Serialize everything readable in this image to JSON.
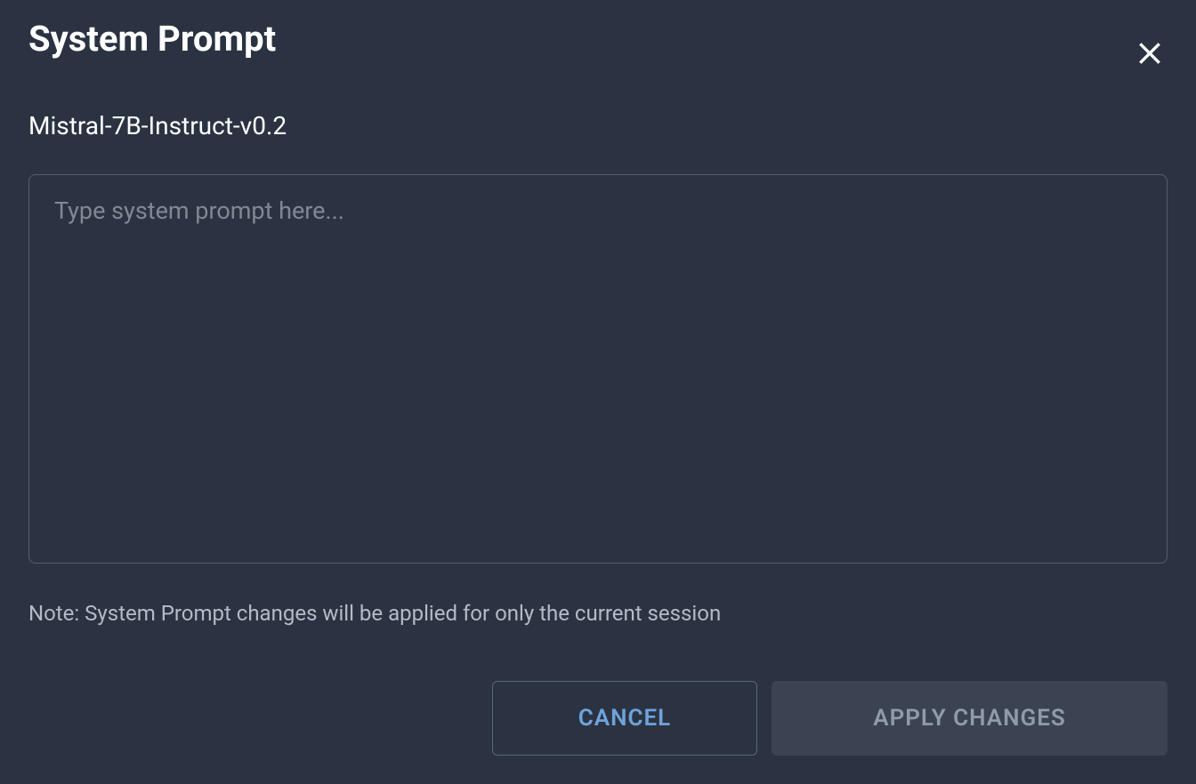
{
  "modal": {
    "title": "System Prompt",
    "model_name": "Mistral-7B-Instruct-v0.2",
    "textarea_placeholder": "Type system prompt here...",
    "textarea_value": "",
    "note": "Note: System Prompt changes will be applied for only the current session",
    "cancel_label": "CANCEL",
    "apply_label": "APPLY CHANGES"
  }
}
